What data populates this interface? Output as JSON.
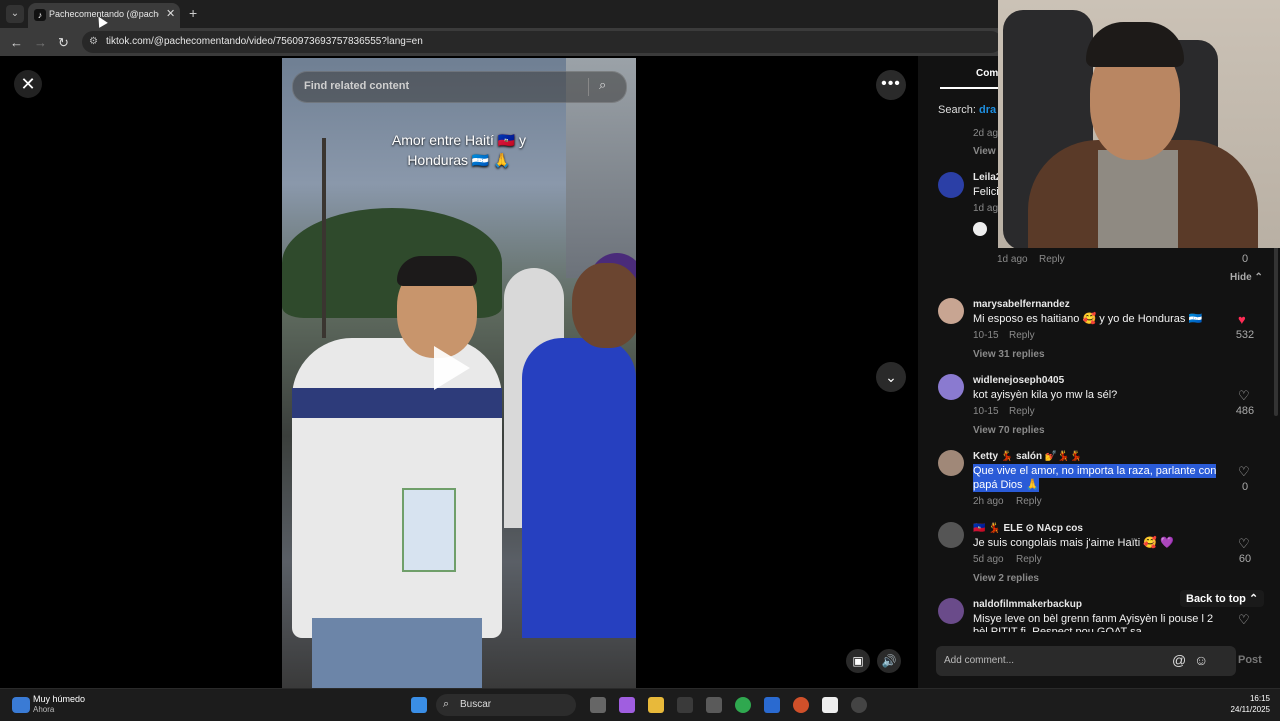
{
  "browser": {
    "tab_title": "Pachecomentando (@pacheco",
    "tab_favicon": "♪",
    "url": "tiktok.com/@pachecomentando/video/7560973693757836555?lang=en"
  },
  "video": {
    "search_placeholder": "Find related content",
    "caption_line1": "Amor entre Haití 🇭🇹 y",
    "caption_line2": "Honduras 🇭🇳 🙏"
  },
  "comments": {
    "tab_label": "Com",
    "search_label": "Search:",
    "search_term": "dra",
    "items": [
      {
        "meta_time": "2d ag",
        "view": "View"
      },
      {
        "user": "Leila2",
        "text": "Felici",
        "time": "1d ag"
      },
      {
        "time": "1d ago",
        "reply": "Reply",
        "likes": "0",
        "hide": "Hide"
      },
      {
        "user": "marysabelfernandez",
        "text": "Mi esposo es haitiano 🥰 y yo de Honduras 🇭🇳",
        "time": "10-15",
        "reply": "Reply",
        "likes": "532",
        "view_replies": "View 31 replies"
      },
      {
        "user": "widlenejoseph0405",
        "text": "kot ayisyèn kila yo mw la sél?",
        "time": "10-15",
        "reply": "Reply",
        "likes": "486",
        "view_replies": "View 70 replies"
      },
      {
        "user": "Ketty 💃 salón 💅💃💃",
        "text1": "Que vive el amor, no importa la raza, parlante con",
        "text2": "papá Dios 🙏",
        "time": "2h ago",
        "reply": "Reply",
        "likes": "0"
      },
      {
        "user": "🇭🇹 💃 ELE ⊙ NAcp cos",
        "text": "Je suis congolais mais j'aime Haïti 🥰 💜",
        "time": "5d ago",
        "reply": "Reply",
        "likes": "60",
        "view_replies": "View 2 replies"
      },
      {
        "user": "naldofilmmakerbackup",
        "text": "Misye leve on bèl grenn fanm Ayisyèn li pouse l 2",
        "text2": "bèl PITIT fi. Respect pou GOAT sa"
      }
    ],
    "back_to_top": "Back to top",
    "add_comment_placeholder": "Add comment...",
    "post": "Post"
  },
  "taskbar": {
    "weather_title": "Muy húmedo",
    "weather_sub": "Ahora",
    "search": "Buscar",
    "time": "16:15",
    "date": "24/11/2025"
  },
  "colors": {
    "link_blue": "#1e8fe1",
    "heart_red": "#fe2c55",
    "highlight": "#2a5bd7"
  }
}
